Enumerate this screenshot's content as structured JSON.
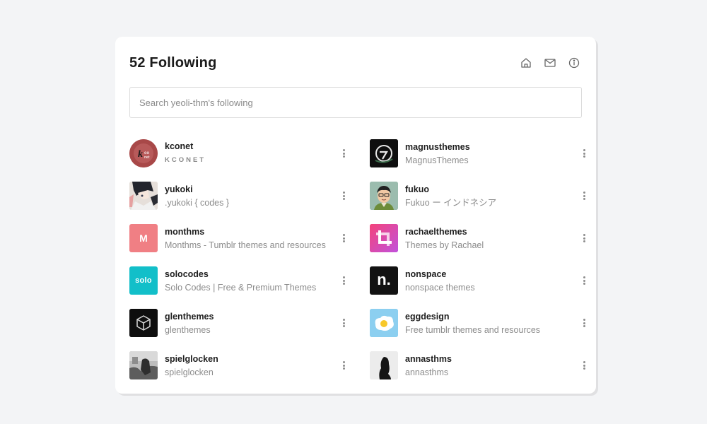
{
  "header": {
    "title": "52 Following",
    "icons": [
      "home-icon",
      "mail-icon",
      "info-icon"
    ]
  },
  "search": {
    "placeholder": "Search yeoli-thm's following",
    "value": ""
  },
  "following": [
    {
      "name": "kconet",
      "subtitle": "KCONET",
      "avatar": "kconet-logo",
      "avatar_color": "#a94a4a"
    },
    {
      "name": "magnusthemes",
      "subtitle": "MagnusThemes",
      "avatar": "magnus-logo",
      "avatar_color": "#111111"
    },
    {
      "name": "yukoki",
      "subtitle": ".yukoki { codes }",
      "avatar": "anime-character-photo",
      "avatar_color": "#6b6f7c"
    },
    {
      "name": "fukuo",
      "subtitle": "Fukuo ー インドネシア",
      "avatar": "cartoon-avatar",
      "avatar_color": "#8fb3a5"
    },
    {
      "name": "monthms",
      "subtitle": "Monthms - Tumblr themes and resources",
      "avatar": "letter-m-logo",
      "avatar_color": "#f07f84",
      "avatar_letter": "M"
    },
    {
      "name": "rachaelthemes",
      "subtitle": "Themes by Rachael",
      "avatar": "crop-logo",
      "avatar_color": "#e54ba0"
    },
    {
      "name": "solocodes",
      "subtitle": "Solo Codes | Free & Premium Themes",
      "avatar": "solo-logo",
      "avatar_color": "#12bfc9",
      "avatar_letter": "solo"
    },
    {
      "name": "nonspace",
      "subtitle": "nonspace themes",
      "avatar": "n-logo",
      "avatar_color": "#121212",
      "avatar_letter": "n."
    },
    {
      "name": "glenthemes",
      "subtitle": "glenthemes",
      "avatar": "cube-logo",
      "avatar_color": "#101010"
    },
    {
      "name": "eggdesign",
      "subtitle": "Free tumblr themes and resources",
      "avatar": "egg-logo",
      "avatar_color": "#8fd0ec"
    },
    {
      "name": "spielglocken",
      "subtitle": "spielglocken",
      "avatar": "grayscale-photo",
      "avatar_color": "#9a9a9a"
    },
    {
      "name": "annasthms",
      "subtitle": "annasthms",
      "avatar": "silhouette-photo",
      "avatar_color": "#e8e8e8"
    }
  ],
  "colors": {
    "background": "#f3f4f6",
    "card": "#ffffff",
    "name_text": "#1e1e1e",
    "subtitle_text": "#8c8c8c"
  }
}
